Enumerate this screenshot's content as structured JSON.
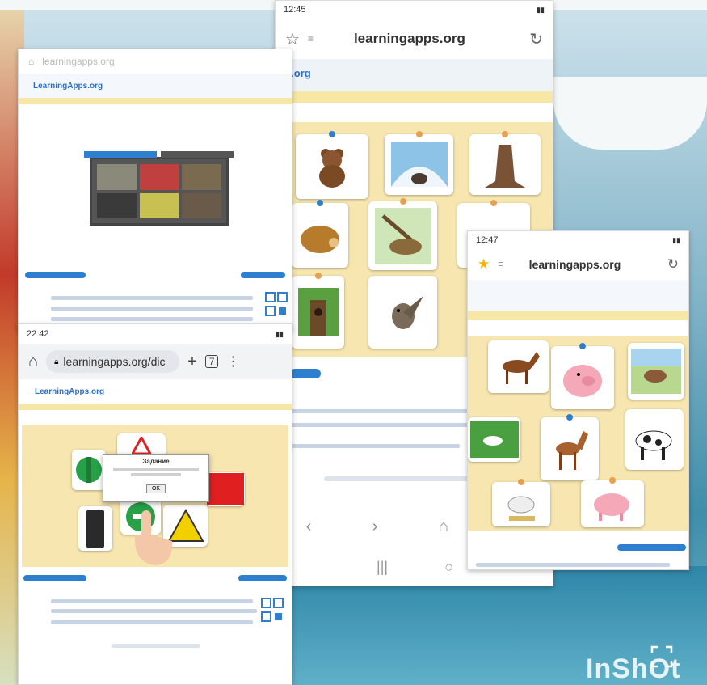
{
  "phone_center": {
    "status_time": "12:45",
    "status_signal": "",
    "url": "learningapps.org",
    "logo_partial": "ps.org"
  },
  "phone_right": {
    "status_time": "12:47",
    "url": "learningapps.org"
  },
  "phone_left_bottom": {
    "status_time": "22:42",
    "url": "learningapps.org/diс",
    "logo": "LearningApps.org",
    "dialog": {
      "title": "Задание",
      "ok_label": "OK"
    }
  },
  "phone_left_top": {
    "url": "learningapps.org",
    "logo": "LearningApps.org"
  },
  "watermark": "InShOt",
  "colors": {
    "accent": "#2f7fd0",
    "game_bg": "#f7e6b0",
    "sign_red": "#e02020",
    "sign_yellow": "#f2d000",
    "sign_green": "#27a048"
  }
}
